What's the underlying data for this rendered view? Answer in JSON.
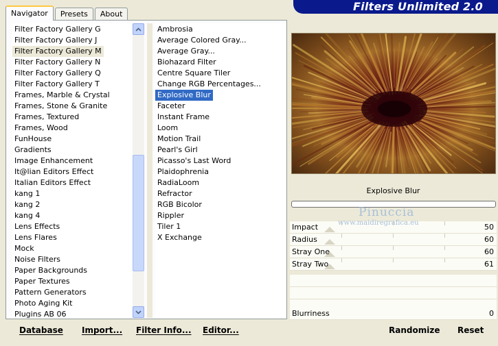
{
  "tabs": [
    {
      "label": "Navigator",
      "active": true
    },
    {
      "label": "Presets",
      "active": false
    },
    {
      "label": "About",
      "active": false
    }
  ],
  "brand": "Filters Unlimited 2.0",
  "categories": [
    "Filter Factory Gallery G",
    "Filter Factory Gallery J",
    "Filter Factory Gallery M",
    "Filter Factory Gallery N",
    "Filter Factory Gallery Q",
    "Filter Factory Gallery T",
    "Frames, Marble & Crystal",
    "Frames, Stone & Granite",
    "Frames, Textured",
    "Frames, Wood",
    "FunHouse",
    "Gradients",
    "Image Enhancement",
    "It@lian Editors Effect",
    "Italian Editors Effect",
    "kang 1",
    "kang 2",
    "kang 4",
    "Lens Effects",
    "Lens Flares",
    "Mock",
    "Noise Filters",
    "Paper Backgrounds",
    "Paper Textures",
    "Pattern Generators",
    "Photo Aging Kit",
    "Plugins AB 06"
  ],
  "selected_category": "Filter Factory Gallery M",
  "filters": [
    "Ambrosia",
    "Average Colored Gray...",
    "Average Gray...",
    "Biohazard Filter",
    "Centre Square Tiler",
    "Change RGB Percentages...",
    "Explosive Blur",
    "Faceter",
    "Instant Frame",
    "Loom",
    "Motion Trail",
    "Pearl's Girl",
    "Picasso's Last Word",
    "Plaidophrenia",
    "RadiaLoom",
    "Refractor",
    "RGB Bicolor",
    "Rippler",
    "Tiler 1",
    "X Exchange"
  ],
  "selected_filter": "Explosive Blur",
  "bottom_buttons": {
    "database": "Database",
    "import": "Import...",
    "filter_info": "Filter Info...",
    "editor": "Editor..."
  },
  "filter_title": "Explosive Blur",
  "sliders": [
    {
      "label": "Impact",
      "value": "50"
    },
    {
      "label": "Radius",
      "value": "60"
    },
    {
      "label": "Stray One",
      "value": "60"
    },
    {
      "label": "Stray Two",
      "value": "61"
    }
  ],
  "blurriness": {
    "label": "Blurriness",
    "value": "0"
  },
  "watermark": {
    "name": "Pinuccia",
    "url": "www.maidiregrafica.eu"
  },
  "actions": {
    "randomize": "Randomize",
    "reset": "Reset"
  },
  "colors": {
    "brand_bg": "#0a1a8c",
    "selection": "#316ac5",
    "dialog_bg": "#ece9d8"
  }
}
